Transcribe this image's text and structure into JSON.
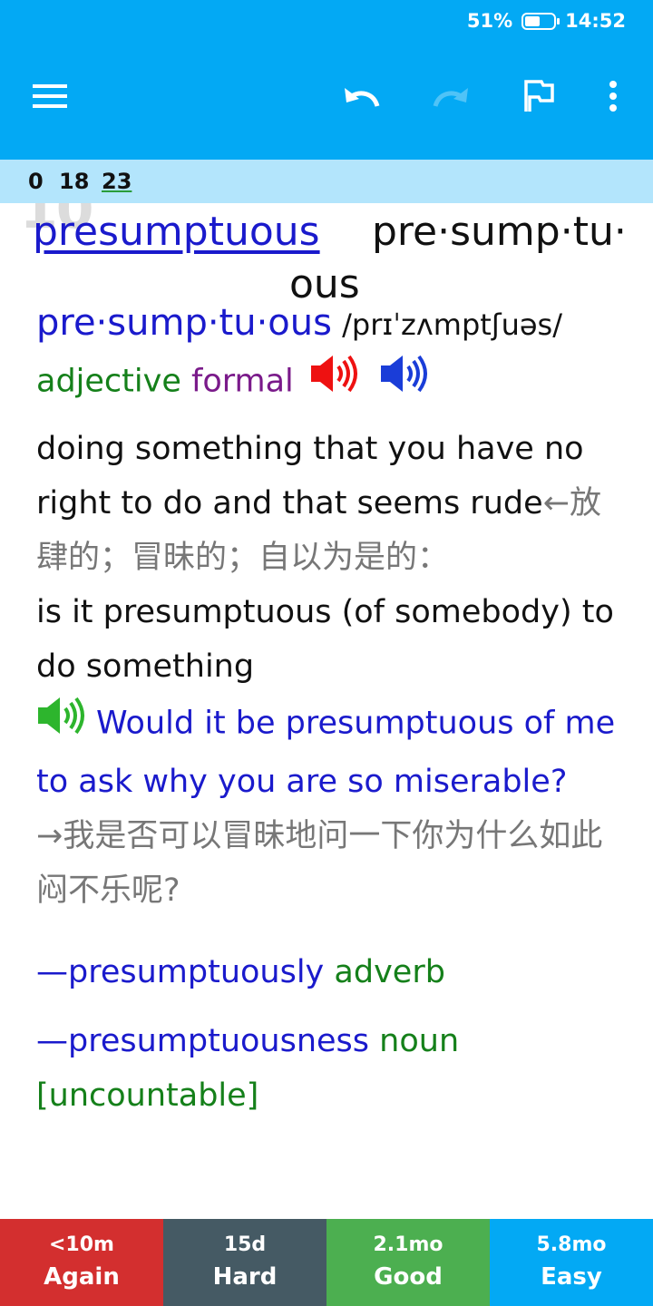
{
  "status": {
    "battery": "51%",
    "time": "14:52"
  },
  "toolbar": {
    "menu_icon": "hamburger-menu-icon",
    "undo_icon": "undo-icon",
    "redo_icon": "redo-icon",
    "flag_icon": "flag-icon",
    "more_icon": "more-vert-icon"
  },
  "counts": {
    "new": "0",
    "learning": "18",
    "review": "23"
  },
  "card": {
    "ghost_text": "10",
    "headword": "presumptuous",
    "hyphenation_line1": "pre·sump·tu·",
    "hyphenation_line2": "ous",
    "entry_headword": "pre·sump·tu·ous",
    "pronunciation": "/prɪˈzʌmptʃuəs/",
    "pos": "adjective",
    "register": "formal",
    "definition_en": "doing something that you have no right to do and that seems rude",
    "definition_zh": "←放肆的；冒昧的；自以为是的：",
    "pattern": "is it presumptuous (of somebody) to do something",
    "example_en": "Would it be presumptuous of me to ask why you are so miserable?",
    "example_zh": "→我是否可以冒昧地问一下你为什么如此闷不乐呢?",
    "derived1_word": "—presumptuously",
    "derived1_pos": "adverb",
    "derived2_word": "—presumptuousness",
    "derived2_pos": "noun",
    "derived2_tag": "[uncountable]"
  },
  "answers": [
    {
      "interval": "<10m",
      "label": "Again",
      "color": "#d32f2f"
    },
    {
      "interval": "15d",
      "label": "Hard",
      "color": "#455a64"
    },
    {
      "interval": "2.1mo",
      "label": "Good",
      "color": "#4caf50"
    },
    {
      "interval": "5.8mo",
      "label": "Easy",
      "color": "#03a9f4"
    }
  ]
}
